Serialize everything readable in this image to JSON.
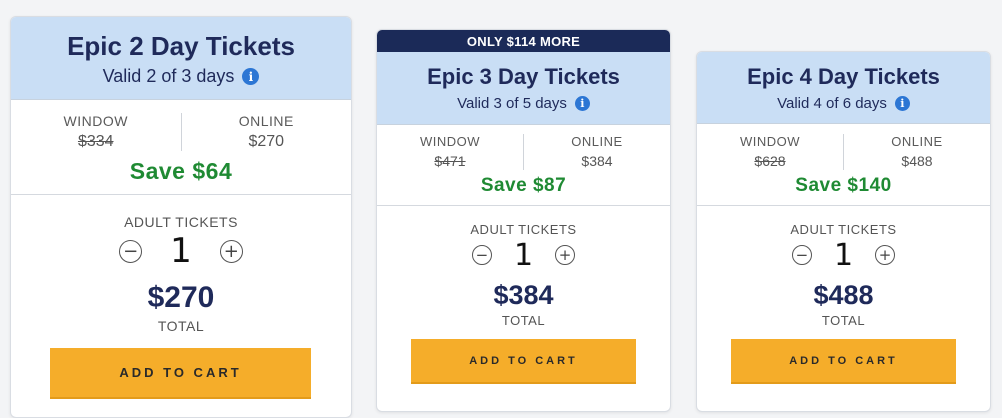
{
  "colors": {
    "header_bg": "#c9def5",
    "title_text": "#1f2a5a",
    "banner_bg": "#1b2a58",
    "save_green": "#1f8a33",
    "cart_button": "#f5ad2a",
    "info_icon": "#2c76d4"
  },
  "icons": {
    "info": "info-icon",
    "minus": "minus-circle-icon",
    "plus": "plus-circle-icon"
  },
  "cards": [
    {
      "banner": "",
      "title": "Epic 2 Day Tickets",
      "valid": "Valid 2 of 3 days",
      "window_label": "WINDOW",
      "window_price": "$334",
      "online_label": "ONLINE",
      "online_price": "$270",
      "save": "Save $64",
      "adult_label": "ADULT TICKETS",
      "quantity": "1",
      "total_price": "$270",
      "total_label": "TOTAL",
      "cart_label": "ADD TO CART"
    },
    {
      "banner": "ONLY $114 MORE",
      "title": "Epic 3 Day Tickets",
      "valid": "Valid 3 of 5 days",
      "window_label": "WINDOW",
      "window_price": "$471",
      "online_label": "ONLINE",
      "online_price": "$384",
      "save": "Save $87",
      "adult_label": "ADULT TICKETS",
      "quantity": "1",
      "total_price": "$384",
      "total_label": "TOTAL",
      "cart_label": "ADD TO CART"
    },
    {
      "banner": "",
      "title": "Epic 4 Day Tickets",
      "valid": "Valid 4 of 6 days",
      "window_label": "WINDOW",
      "window_price": "$628",
      "online_label": "ONLINE",
      "online_price": "$488",
      "save": "Save $140",
      "adult_label": "ADULT TICKETS",
      "quantity": "1",
      "total_price": "$488",
      "total_label": "TOTAL",
      "cart_label": "ADD TO CART"
    }
  ]
}
